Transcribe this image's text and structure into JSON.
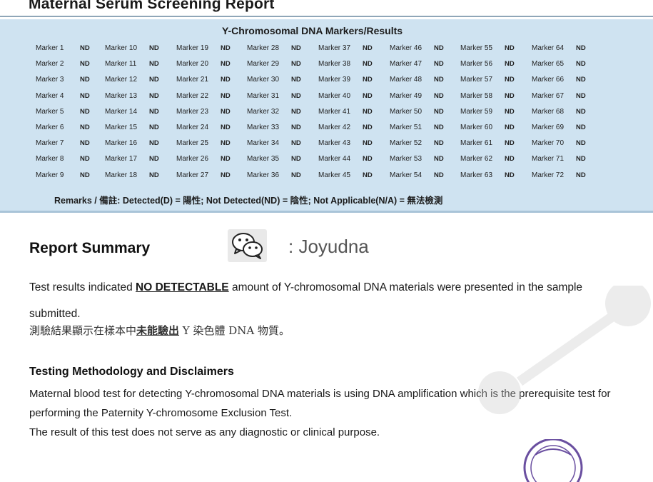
{
  "report": {
    "title": "Maternal Serum Screening Report"
  },
  "markers": {
    "title": "Y-Chromosomal DNA Markers/Results",
    "columns": [
      [
        "Marker 1",
        "Marker 2",
        "Marker 3",
        "Marker 4",
        "Marker 5",
        "Marker 6",
        "Marker 7",
        "Marker 8",
        "Marker 9"
      ],
      [
        "Marker 10",
        "Marker 11",
        "Marker 12",
        "Marker 13",
        "Marker 14",
        "Marker 15",
        "Marker 16",
        "Marker 17",
        "Marker 18"
      ],
      [
        "Marker 19",
        "Marker 20",
        "Marker 21",
        "Marker 22",
        "Marker 23",
        "Marker 24",
        "Marker 25",
        "Marker 26",
        "Marker 27"
      ],
      [
        "Marker 28",
        "Marker 29",
        "Marker 30",
        "Marker 31",
        "Marker 32",
        "Marker 33",
        "Marker 34",
        "Marker 35",
        "Marker 36"
      ],
      [
        "Marker 37",
        "Marker 38",
        "Marker 39",
        "Marker 40",
        "Marker 41",
        "Marker 42",
        "Marker 43",
        "Marker 44",
        "Marker 45"
      ],
      [
        "Marker 46",
        "Marker 47",
        "Marker 48",
        "Marker 49",
        "Marker 50",
        "Marker 51",
        "Marker 52",
        "Marker 53",
        "Marker 54"
      ],
      [
        "Marker 55",
        "Marker 56",
        "Marker 57",
        "Marker 58",
        "Marker 59",
        "Marker 60",
        "Marker 61",
        "Marker 62",
        "Marker 63"
      ],
      [
        "Marker 64",
        "Marker 65",
        "Marker 66",
        "Marker 67",
        "Marker 68",
        "Marker 69",
        "Marker 70",
        "Marker 71",
        "Marker 72"
      ]
    ],
    "result": "ND",
    "remarks": "Remarks / 備註: Detected(D) = 陽性; Not Detected(ND) = 陰性; Not Applicable(N/A) = 無法檢測"
  },
  "summary": {
    "title": "Report Summary",
    "brand": ": Joyudna",
    "text_before": "Test results indicated ",
    "text_emphasis": "NO DETECTABLE",
    "text_after": " amount of Y-chromosomal DNA materials were presented in the sample submitted.",
    "zh_before": "測驗結果顯示在樣本中",
    "zh_emphasis": "未能驗出",
    "zh_after": " Y 染色體 DNA 物質。"
  },
  "methodology": {
    "title": "Testing Methodology and Disclaimers",
    "line1": "Maternal blood test for detecting Y-chromosomal DNA materials is using DNA amplification which is the prerequisite test for performing the Paternity Y-chromosome Exclusion Test.",
    "line2": "The result of this test does not serve as any diagnostic or clinical purpose."
  },
  "icons": {
    "wechat": "wechat-icon",
    "seal": "laboratory-seal-icon",
    "watermark": "dna-watermark-icon"
  },
  "colors": {
    "panel": "#cfe3f1",
    "title_rule": "#8fa6b8"
  }
}
